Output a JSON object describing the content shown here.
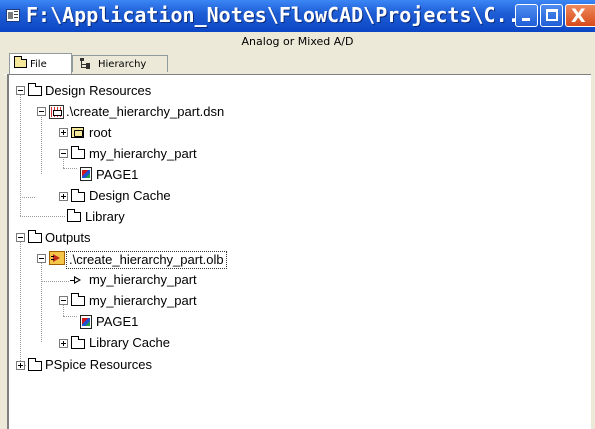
{
  "window": {
    "title": "F:\\Application_Notes\\FlowCAD\\Projects\\C...",
    "buttons": {
      "minimize": "minimize",
      "maximize": "maximize",
      "close": "X"
    }
  },
  "pane": {
    "title": "Analog or Mixed A/D",
    "tabs": [
      {
        "label": "File",
        "icon": "folder-icon",
        "active": true
      },
      {
        "label": "Hierarchy",
        "icon": "hierarchy-icon",
        "active": false
      }
    ]
  },
  "tree": [
    {
      "label": "Design Resources",
      "icon": "folder-icon",
      "expander": "expanded"
    },
    {
      "label": ".\\create_hierarchy_part.dsn",
      "icon": "design-file-icon",
      "expander": "expanded"
    },
    {
      "label": "root",
      "icon": "root-schematic-icon",
      "expander": "collapsed"
    },
    {
      "label": "my_hierarchy_part",
      "icon": "folder-icon",
      "expander": "expanded"
    },
    {
      "label": "PAGE1",
      "icon": "schematic-page-icon",
      "expander": "none"
    },
    {
      "label": "Design Cache",
      "icon": "folder-icon",
      "expander": "collapsed"
    },
    {
      "label": "Library",
      "icon": "folder-icon",
      "expander": "none"
    },
    {
      "label": "Outputs",
      "icon": "folder-icon",
      "expander": "expanded"
    },
    {
      "label": ".\\create_hierarchy_part.olb",
      "icon": "library-file-icon",
      "expander": "expanded",
      "selected": true
    },
    {
      "label": "my_hierarchy_part",
      "icon": "part-icon",
      "expander": "none"
    },
    {
      "label": "my_hierarchy_part",
      "icon": "folder-icon",
      "expander": "expanded"
    },
    {
      "label": "PAGE1",
      "icon": "schematic-page-icon",
      "expander": "none"
    },
    {
      "label": "Library Cache",
      "icon": "folder-icon",
      "expander": "collapsed"
    },
    {
      "label": "PSpice Resources",
      "icon": "folder-icon",
      "expander": "collapsed"
    }
  ]
}
